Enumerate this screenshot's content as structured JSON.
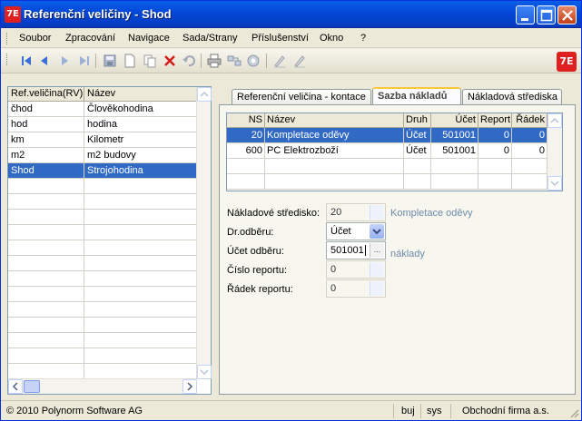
{
  "window": {
    "title": "Referenční veličiny - Shod",
    "logo_text": "7E"
  },
  "menu": {
    "items": [
      "Soubor",
      "Zpracování",
      "Navigace",
      "Sada/Strany",
      "Příslušenství",
      "Okno",
      "?"
    ]
  },
  "toolbar": {
    "icons": [
      "first-record-icon",
      "previous-record-icon",
      "next-record-icon",
      "last-record-icon",
      "save-icon",
      "new-icon",
      "copy-icon",
      "delete-icon",
      "undo-icon",
      "print-icon",
      "link-icon",
      "refresh-icon",
      "edit-icon",
      "edit-alt-icon"
    ],
    "brand_logo_text": "7E"
  },
  "left_grid": {
    "headers": [
      "Ref.veličina(RV)",
      "Název"
    ],
    "rows": [
      [
        "čhod",
        "Člověkohodina"
      ],
      [
        "hod",
        "hodina"
      ],
      [
        "km",
        "Kilometr"
      ],
      [
        "m2",
        "m2 budovy"
      ],
      [
        "Shod",
        "Strojohodina"
      ]
    ],
    "selected_row": 4
  },
  "tabs": [
    "Referenční veličina - kontace",
    "Sazba nákladů",
    "Nákladová střediska"
  ],
  "active_tab": 1,
  "rate_grid": {
    "headers": [
      "NS",
      "Název",
      "Druh",
      "Účet",
      "Report",
      "Řádek"
    ],
    "rows": [
      [
        "20",
        "Kompletace oděvy",
        "Účet",
        "501001",
        "0",
        "0"
      ],
      [
        "600",
        "PC Elektrozboží",
        "Účet",
        "501001",
        "0",
        "0"
      ]
    ],
    "selected_row": 0
  },
  "form": {
    "cost_center_label": "Nákladové středisko:",
    "cost_center_value": "20",
    "cost_center_hint": "Kompletace oděvy",
    "draw_type_label": "Dr.odběru:",
    "draw_type_value": "Účet",
    "account_label": "Účet odběru:",
    "account_value": "501001",
    "account_hint": "náklady",
    "report_label": "Číslo reportu:",
    "report_value": "0",
    "row_label": "Řádek reportu:",
    "row_value": "0",
    "pick_glyph": "..."
  },
  "status": {
    "copyright": "© 2010 Polynorm Software AG",
    "user": "buj",
    "system": "sys",
    "company": "Obchodní firma a.s."
  }
}
